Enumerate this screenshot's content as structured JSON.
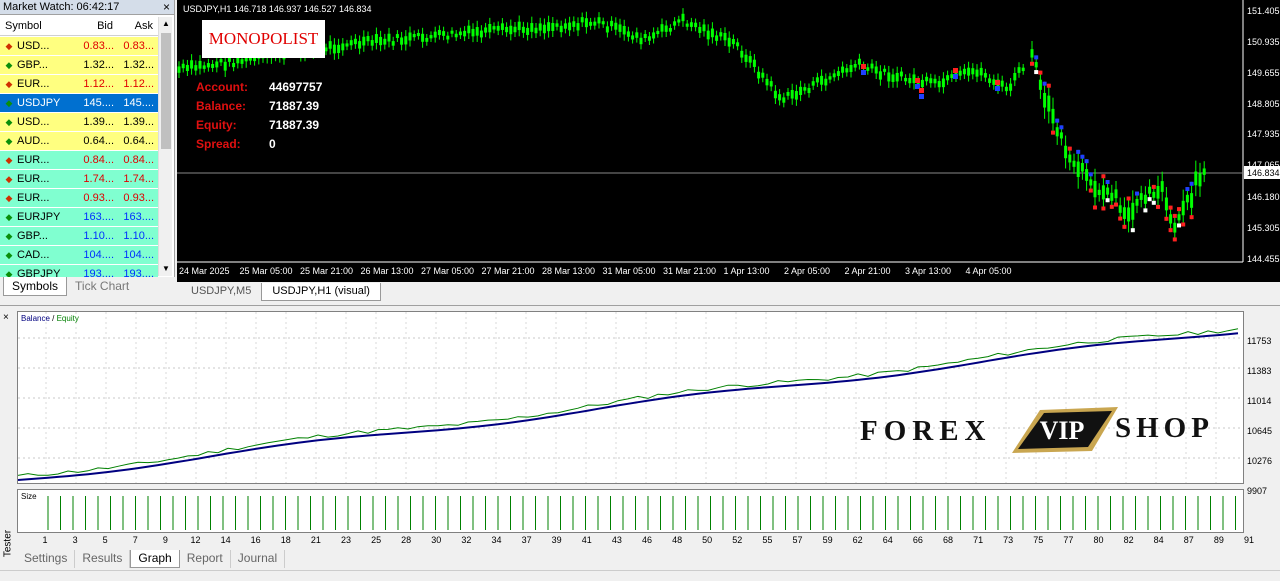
{
  "market_watch": {
    "title": "Market Watch: 06:42:17",
    "close": "×",
    "headers": {
      "symbol": "Symbol",
      "bid": "Bid",
      "ask": "Ask"
    },
    "rows": [
      {
        "symbol": "USD...",
        "bid": "0.83...",
        "ask": "0.83...",
        "dir": "down",
        "style": "yellow",
        "color": "red"
      },
      {
        "symbol": "GBP...",
        "bid": "1.32...",
        "ask": "1.32...",
        "dir": "up",
        "style": "yellow",
        "color": "black"
      },
      {
        "symbol": "EUR...",
        "bid": "1.12...",
        "ask": "1.12...",
        "dir": "down",
        "style": "yellow",
        "color": "red"
      },
      {
        "symbol": "USDJPY",
        "bid": "145....",
        "ask": "145....",
        "dir": "up",
        "style": "sel",
        "color": "white"
      },
      {
        "symbol": "USD...",
        "bid": "1.39...",
        "ask": "1.39...",
        "dir": "up",
        "style": "yellow",
        "color": "black"
      },
      {
        "symbol": "AUD...",
        "bid": "0.64...",
        "ask": "0.64...",
        "dir": "up",
        "style": "yellow",
        "color": "black"
      },
      {
        "symbol": "EUR...",
        "bid": "0.84...",
        "ask": "0.84...",
        "dir": "down",
        "style": "cyan",
        "color": "red"
      },
      {
        "symbol": "EUR...",
        "bid": "1.74...",
        "ask": "1.74...",
        "dir": "down",
        "style": "cyan",
        "color": "red"
      },
      {
        "symbol": "EUR...",
        "bid": "0.93...",
        "ask": "0.93...",
        "dir": "down",
        "style": "cyan",
        "color": "red"
      },
      {
        "symbol": "EURJPY",
        "bid": "163....",
        "ask": "163....",
        "dir": "up",
        "style": "cyan",
        "color": "blue"
      },
      {
        "symbol": "GBP...",
        "bid": "1.10...",
        "ask": "1.10...",
        "dir": "up",
        "style": "cyan",
        "color": "blue"
      },
      {
        "symbol": "CAD...",
        "bid": "104....",
        "ask": "104....",
        "dir": "up",
        "style": "cyan",
        "color": "blue"
      },
      {
        "symbol": "GBPJPY",
        "bid": "193....",
        "ask": "193....",
        "dir": "up",
        "style": "cyan",
        "color": "blue"
      }
    ],
    "tabs": [
      "Symbols",
      "Tick Chart"
    ]
  },
  "chart": {
    "info": "USDJPY,H1  146.718 146.937 146.527 146.834",
    "logo": "MONOPOLIST",
    "account": {
      "label": "Account:",
      "value": "44697757"
    },
    "balance": {
      "label": "Balance:",
      "value": "71887.39"
    },
    "equity": {
      "label": "Equity:",
      "value": "71887.39"
    },
    "spread": {
      "label": "Spread:",
      "value": "0"
    },
    "current_price": "146.834",
    "price_labels": [
      "151.405",
      "150.935",
      "149.655",
      "148.805",
      "147.935",
      "147.065",
      "146.180",
      "145.305",
      "144.455"
    ],
    "time_labels": [
      "24 Mar 2025",
      "25 Mar 05:00",
      "25 Mar 21:00",
      "26 Mar 13:00",
      "27 Mar 05:00",
      "27 Mar 21:00",
      "28 Mar 13:00",
      "31 Mar 05:00",
      "31 Mar 21:00",
      "1 Apr 13:00",
      "2 Apr 05:00",
      "2 Apr 21:00",
      "3 Apr 13:00",
      "4 Apr 05:00"
    ],
    "tabs": [
      "USDJPY,M5",
      "USDJPY,H1 (visual)"
    ],
    "colors": {
      "candle": "#00ff00",
      "bg": "#000000"
    }
  },
  "tester": {
    "side_label": "Tester",
    "close": "×",
    "legend_balance": "Balance",
    "legend_sep": " / ",
    "legend_equity": "Equity",
    "size_label": "Size",
    "y_labels": [
      "11753",
      "11383",
      "11014",
      "10645",
      "10276",
      "9907"
    ],
    "x_labels": [
      "1",
      "3",
      "5",
      "7",
      "9",
      "12",
      "14",
      "16",
      "18",
      "21",
      "23",
      "25",
      "28",
      "30",
      "32",
      "34",
      "37",
      "39",
      "41",
      "43",
      "46",
      "48",
      "50",
      "52",
      "55",
      "57",
      "59",
      "62",
      "64",
      "66",
      "68",
      "71",
      "73",
      "75",
      "77",
      "80",
      "82",
      "84",
      "87",
      "89",
      "91"
    ],
    "tabs": [
      "Settings",
      "Results",
      "Graph",
      "Report",
      "Journal"
    ],
    "active_tab": "Graph",
    "colors": {
      "balance": "#000080",
      "equity": "#008000"
    }
  },
  "watermark": {
    "left": "FOREX",
    "middle": "VIP",
    "right": "SHOP"
  }
}
